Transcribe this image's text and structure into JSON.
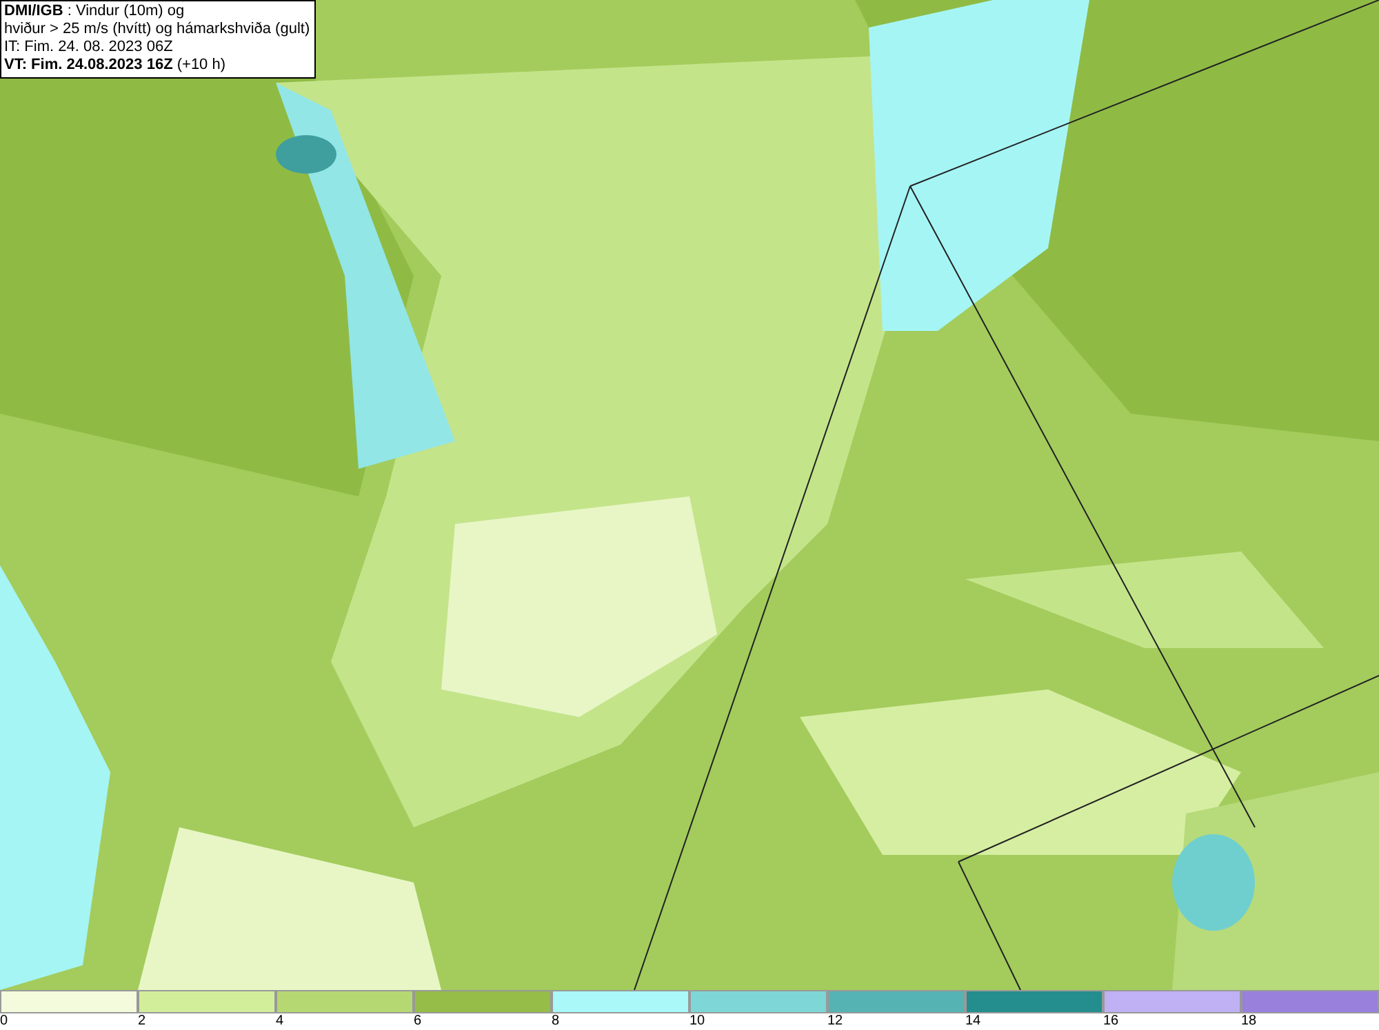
{
  "info_box": {
    "lines": [
      "**DMI/IGB** : Vindur (10m) og",
      "hviður > 25 m/s (hvítt) og hámarkshviða (gult)",
      "IT: Fim. 24. 08. 2023 06Z",
      "**VT: Fim. 24.08.2023 16Z** (+10 h)"
    ]
  },
  "legend": {
    "swatches": [
      {
        "color": "#f3fbdc",
        "label": "0"
      },
      {
        "color": "#d3ee9b",
        "label": "2"
      },
      {
        "color": "#b5d873",
        "label": "4"
      },
      {
        "color": "#95bd48",
        "label": "6"
      },
      {
        "color": "#aaf8f8",
        "label": "8"
      },
      {
        "color": "#7fd6d6",
        "label": "10"
      },
      {
        "color": "#55b3b3",
        "label": "12"
      },
      {
        "color": "#248e8e",
        "label": "14"
      },
      {
        "color": "#c0b0f4",
        "label": "16"
      },
      {
        "color": "#9880dc",
        "label": "18"
      }
    ]
  }
}
